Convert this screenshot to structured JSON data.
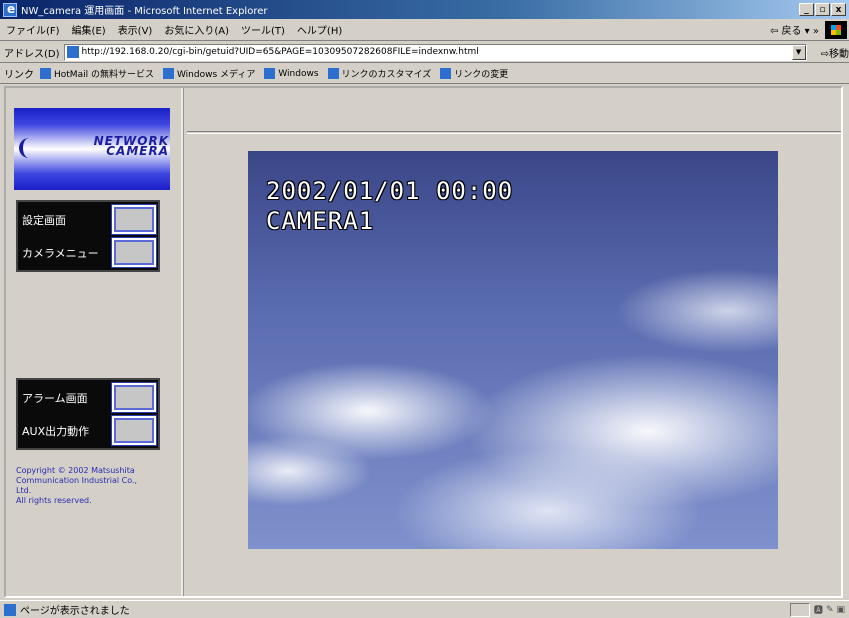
{
  "window": {
    "title": "NW_camera 運用画面 - Microsoft Internet Explorer",
    "min": "_",
    "max": "▫",
    "close": "x"
  },
  "menu": {
    "items": [
      "ファイル(F)",
      "編集(E)",
      "表示(V)",
      "お気に入り(A)",
      "ツール(T)",
      "ヘルプ(H)"
    ],
    "back_label": "⇦ 戻る ▾ »"
  },
  "address": {
    "label": "アドレス(D)",
    "url": "http://192.168.0.20/cgi-bin/getuid?UID=65&PAGE=10309507282608FILE=indexnw.html",
    "go_label": "⇨移動"
  },
  "links": {
    "label": "リンク",
    "items": [
      "HotMail の無料サービス",
      "Windows メディア",
      "Windows",
      "リンクのカスタマイズ",
      "リンクの変更"
    ]
  },
  "logo": {
    "line1": "NETWORK",
    "line2": "CAMERA"
  },
  "buttons": {
    "settings": "設定画面",
    "camera_menu": "カメラメニュー",
    "alarm": "アラーム画面",
    "aux": "AUX出力動作"
  },
  "copyright": {
    "line1": "Copyright © 2002 Matsushita",
    "line2": "Communication Industrial Co.,",
    "line3": "Ltd.",
    "line4": "All rights reserved."
  },
  "camera": {
    "timestamp": "2002/01/01 00:00",
    "name": "CAMERA1"
  },
  "status": {
    "text": "ページが表示されました"
  }
}
